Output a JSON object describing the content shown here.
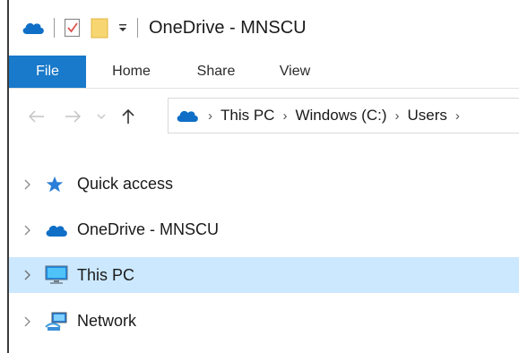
{
  "window": {
    "title": "OneDrive - MNSCU"
  },
  "ribbon": {
    "tabs": [
      {
        "label": "File",
        "active": true
      },
      {
        "label": "Home"
      },
      {
        "label": "Share"
      },
      {
        "label": "View"
      }
    ]
  },
  "address_bar": {
    "crumbs": [
      "This PC",
      "Windows (C:)",
      "Users"
    ]
  },
  "nav_tree": {
    "items": [
      {
        "label": "Quick access",
        "icon": "star-icon"
      },
      {
        "label": "OneDrive - MNSCU",
        "icon": "cloud-icon"
      },
      {
        "label": "This PC",
        "icon": "computer-icon",
        "selected": true
      },
      {
        "label": "Network",
        "icon": "network-icon"
      }
    ]
  },
  "colors": {
    "accent": "#1979ca",
    "selection": "#cce8ff",
    "onedrive_blue": "#0f6fc6"
  }
}
